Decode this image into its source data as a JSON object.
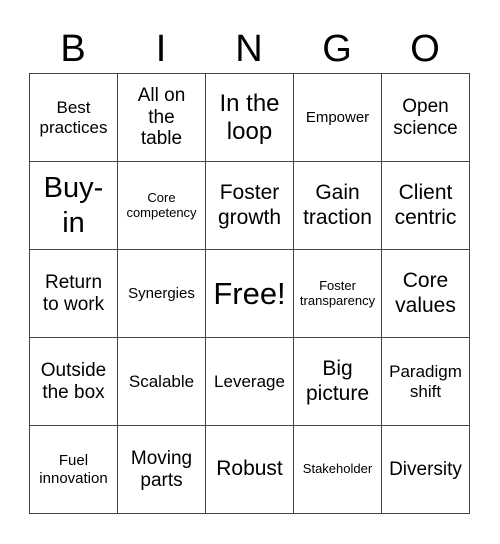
{
  "header": {
    "letters": [
      "B",
      "I",
      "N",
      "G",
      "O"
    ]
  },
  "grid": {
    "rows": [
      [
        {
          "text": "Best practices",
          "lines": [
            "Best",
            "practices"
          ],
          "size": "s-md"
        },
        {
          "text": "All on the table",
          "lines": [
            "All on",
            "the",
            "table"
          ],
          "size": "s-ml"
        },
        {
          "text": "In the loop",
          "lines": [
            "In the",
            "loop"
          ],
          "size": "s-xl"
        },
        {
          "text": "Empower",
          "lines": [
            "Empower"
          ],
          "size": "s-sm"
        },
        {
          "text": "Open science",
          "lines": [
            "Open",
            "science"
          ],
          "size": "s-ml"
        }
      ],
      [
        {
          "text": "Buy-in",
          "lines": [
            "Buy-",
            "in"
          ],
          "size": "s-xxl"
        },
        {
          "text": "Core competency",
          "lines": [
            "Core",
            "competency"
          ],
          "size": "s-xs"
        },
        {
          "text": "Foster growth",
          "lines": [
            "Foster",
            "growth"
          ],
          "size": "s-lg"
        },
        {
          "text": "Gain traction",
          "lines": [
            "Gain",
            "traction"
          ],
          "size": "s-lg"
        },
        {
          "text": "Client centric",
          "lines": [
            "Client",
            "centric"
          ],
          "size": "s-lg"
        }
      ],
      [
        {
          "text": "Return to work",
          "lines": [
            "Return",
            "to work"
          ],
          "size": "s-ml"
        },
        {
          "text": "Synergies",
          "lines": [
            "Synergies"
          ],
          "size": "s-sm"
        },
        {
          "text": "Free!",
          "lines": [
            "Free!"
          ],
          "size": "s-free"
        },
        {
          "text": "Foster transparency",
          "lines": [
            "Foster",
            "transparency"
          ],
          "size": "s-xs"
        },
        {
          "text": "Core values",
          "lines": [
            "Core",
            "values"
          ],
          "size": "s-lg"
        }
      ],
      [
        {
          "text": "Outside the box",
          "lines": [
            "Outside",
            "the box"
          ],
          "size": "s-ml"
        },
        {
          "text": "Scalable",
          "lines": [
            "Scalable"
          ],
          "size": "s-md"
        },
        {
          "text": "Leverage",
          "lines": [
            "Leverage"
          ],
          "size": "s-md"
        },
        {
          "text": "Big picture",
          "lines": [
            "Big",
            "picture"
          ],
          "size": "s-lg"
        },
        {
          "text": "Paradigm shift",
          "lines": [
            "Paradigm",
            "shift"
          ],
          "size": "s-md"
        }
      ],
      [
        {
          "text": "Fuel innovation",
          "lines": [
            "Fuel",
            "innovation"
          ],
          "size": "s-sm"
        },
        {
          "text": "Moving parts",
          "lines": [
            "Moving",
            "parts"
          ],
          "size": "s-ml"
        },
        {
          "text": "Robust",
          "lines": [
            "Robust"
          ],
          "size": "s-lg"
        },
        {
          "text": "Stakeholder",
          "lines": [
            "Stakeholder"
          ],
          "size": "s-xs"
        },
        {
          "text": "Diversity",
          "lines": [
            "Diversity"
          ],
          "size": "s-ml"
        }
      ]
    ]
  }
}
